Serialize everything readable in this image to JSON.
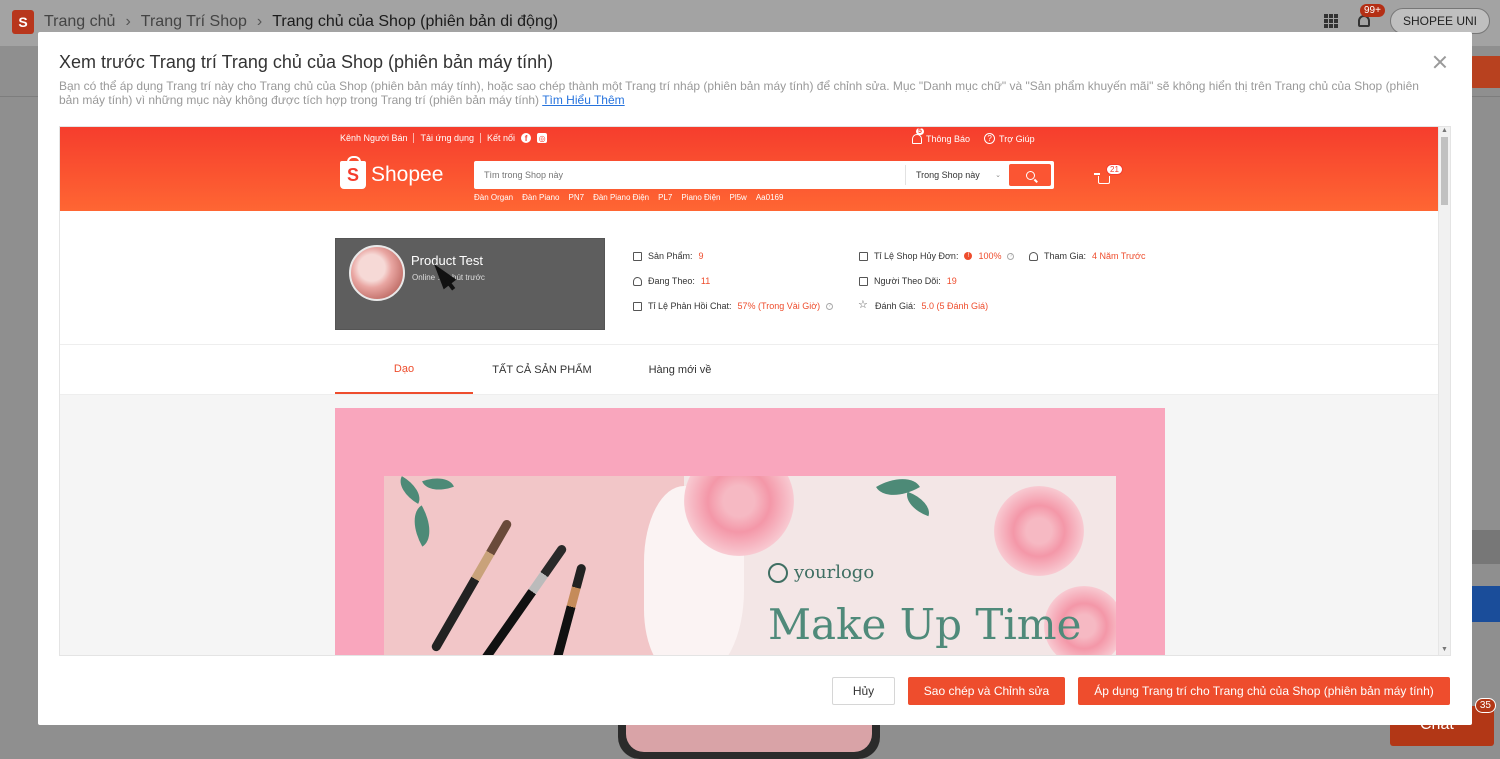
{
  "background": {
    "breadcrumb": {
      "home": "Trang chủ",
      "section": "Trang Trí Shop",
      "current": "Trang chủ của Shop (phiên bản di động)"
    },
    "notification_badge": "99+",
    "shop_button": "SHOPEE UNI",
    "chat_label": "Chat",
    "chat_count": "35"
  },
  "modal": {
    "title": "Xem trước Trang trí Trang chủ của Shop (phiên bản máy tính)",
    "description": "Bạn có thể áp dụng Trang trí này cho Trang chủ của Shop (phiên bản máy tính), hoặc sao chép thành một Trang trí nháp (phiên bản máy tính) để chỉnh sửa. Mục \"Danh mục chữ\" và \"Sản phẩm khuyến mãi\" sẽ không hiển thị trên Trang chủ của Shop (phiên bản máy tính) vì những mục này không được tích hợp trong Trang trí (phiên bản máy tính)",
    "learn_more": "Tìm Hiểu Thêm",
    "buttons": {
      "cancel": "Hủy",
      "copy_edit": "Sao chép và Chỉnh sửa",
      "apply": "Áp dụng Trang trí cho Trang chủ của Shop (phiên bản máy tính)"
    }
  },
  "preview": {
    "topbar": {
      "seller_channel": "Kênh Người Bán",
      "download_app": "Tải ứng dụng",
      "connect": "Kết nối",
      "notifications": "Thông Báo",
      "notifications_count": "5",
      "help": "Trợ Giúp"
    },
    "brand": "Shopee",
    "search": {
      "placeholder": "Tìm trong Shop này",
      "scope": "Trong Shop này"
    },
    "search_hints": [
      "Đàn Organ",
      "Đàn Piano",
      "PN7",
      "Đàn Piano Điện",
      "PL7",
      "Piano Điện",
      "Pl5w",
      "Aa0169"
    ],
    "cart_count": "21",
    "shop": {
      "name": "Product Test",
      "status": "Online … phút trước"
    },
    "stats": [
      {
        "label": "Sản Phẩm:",
        "value": "9",
        "icon": "store-icon"
      },
      {
        "label": "Tỉ Lệ Shop Hủy Đơn:",
        "value": "100%",
        "icon": "cancel-rate-icon"
      },
      {
        "label": "Tham Gia:",
        "value": "4 Năm Trước",
        "icon": "person-icon"
      },
      {
        "label": "Đang Theo:",
        "value": "11",
        "icon": "follow-icon"
      },
      {
        "label": "Người Theo Dõi:",
        "value": "19",
        "icon": "followers-icon"
      },
      {
        "label": "Tỉ Lệ Phản Hồi Chat:",
        "value": "57% (Trong Vài Giờ)",
        "icon": "chat-icon"
      },
      {
        "label": "Đánh Giá:",
        "value": "5.0 (5 Đánh Giá)",
        "icon": "star-icon"
      }
    ],
    "tabs": [
      "Dạo",
      "TẤT CẢ SẢN PHẨM",
      "Hàng mới về"
    ],
    "banner": {
      "logo_text": "yourlogo",
      "headline": "Make Up Time"
    }
  }
}
